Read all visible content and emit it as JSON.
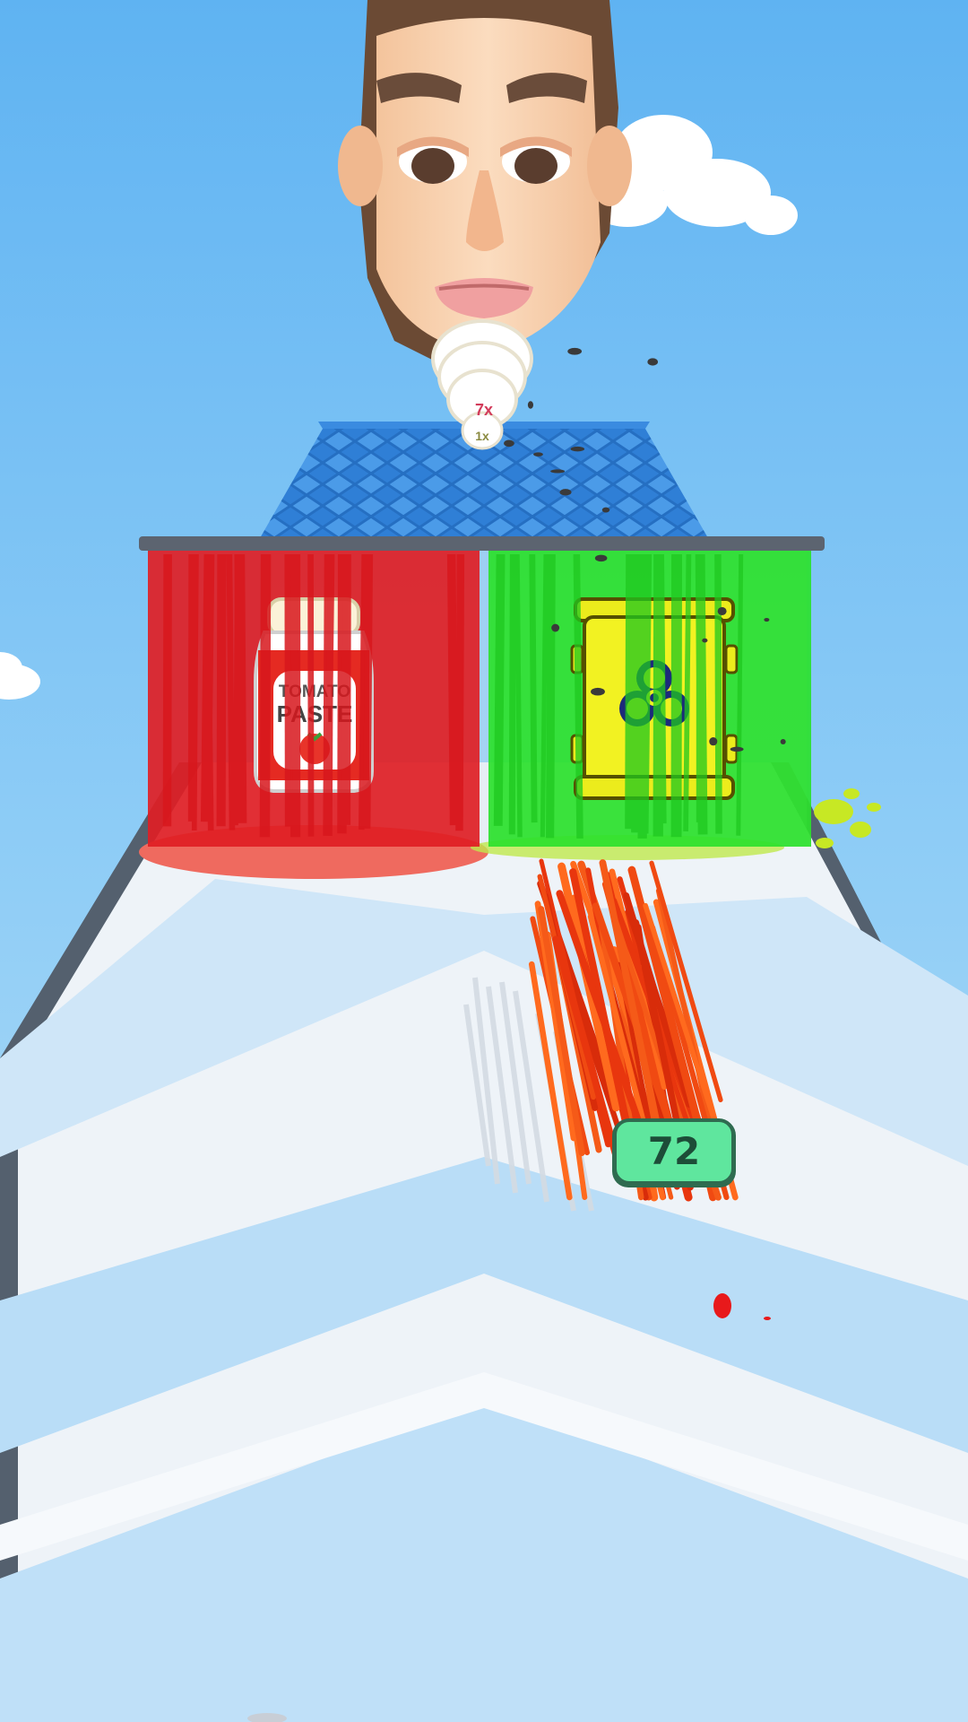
{
  "game": {
    "counter_value": "72",
    "plate_multiplier_top": "7x",
    "plate_multiplier_bottom": "1x"
  },
  "gates": [
    {
      "label_line1": "TOMATO",
      "label_line2": "PASTE",
      "item": "tomato-paste-jar-icon",
      "color": "#e01e24"
    },
    {
      "label_line1": "",
      "label_line2": "",
      "item": "biohazard-barrel-icon",
      "color": "#22dd22"
    }
  ],
  "colors": {
    "sky": "#6bbcf2",
    "track": "#eef3f8",
    "track_stripe": "#b9ddf7",
    "counter_bg": "#5fe69e",
    "counter_text": "#1d4d38",
    "noodles": "#f04a12",
    "grate": "#2f7fd6"
  }
}
